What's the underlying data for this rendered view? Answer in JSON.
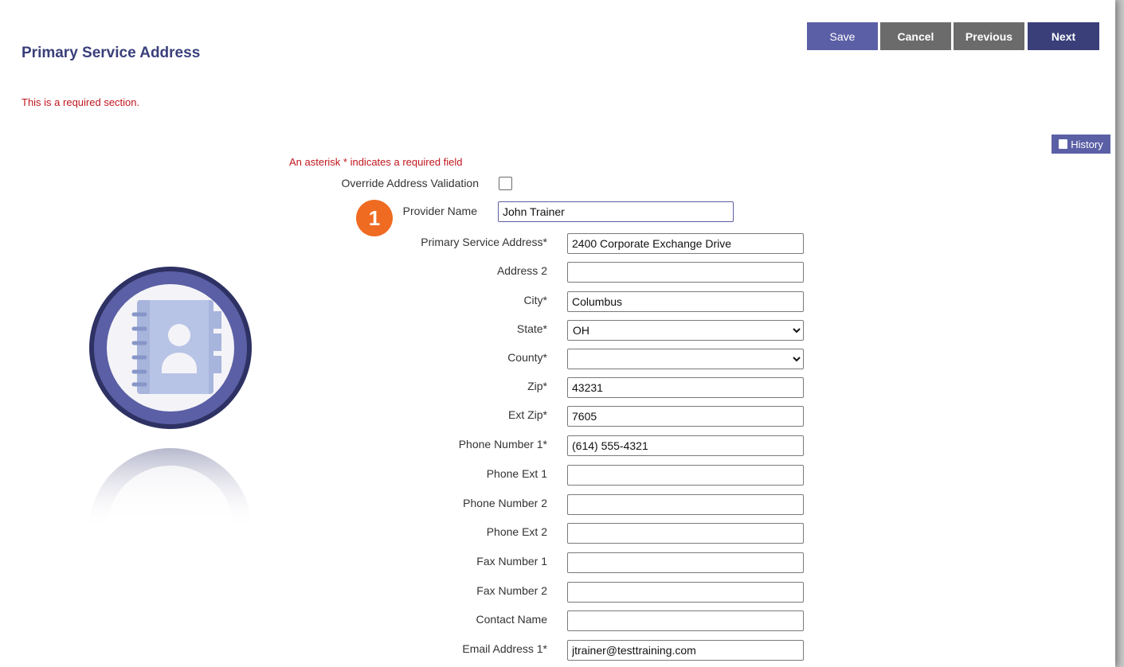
{
  "header": {
    "title": "Primary Service Address",
    "required_section_note": "This is a required section."
  },
  "toolbar": {
    "save": "Save",
    "cancel": "Cancel",
    "previous": "Previous",
    "next": "Next"
  },
  "history_button": "History",
  "form": {
    "asterisk_note": "An asterisk * indicates a required field",
    "override_label": "Override Address Validation",
    "override_checked": false,
    "provider_name_label": "Provider Name",
    "provider_name_value": "John Trainer",
    "step_badge": "1",
    "fields": [
      {
        "label": "Primary Service Address*",
        "value": "2400 Corporate Exchange Drive"
      },
      {
        "label": "Address 2",
        "value": ""
      },
      {
        "label": "City*",
        "value": "Columbus"
      },
      {
        "label": "State*",
        "value": "OH"
      },
      {
        "label": "County*",
        "value": ""
      },
      {
        "label": "Zip*",
        "value": "43231"
      },
      {
        "label": "Ext Zip*",
        "value": "7605"
      },
      {
        "label": "Phone Number 1*",
        "value": "(614) 555-4321"
      },
      {
        "label": "Phone Ext 1",
        "value": ""
      },
      {
        "label": "Phone Number 2",
        "value": ""
      },
      {
        "label": "Phone Ext 2",
        "value": ""
      },
      {
        "label": "Fax Number 1",
        "value": ""
      },
      {
        "label": "Fax Number 2",
        "value": ""
      },
      {
        "label": "Contact Name",
        "value": ""
      },
      {
        "label": "Email Address 1*",
        "value": "jtrainer@testtraining.com"
      }
    ]
  },
  "colors": {
    "primary_button": "#5b5fa5",
    "secondary_button": "#6b6b6b",
    "dark_button": "#3a3f7a",
    "required_text": "#c0171e",
    "badge": "#ef6b22"
  },
  "icons": {
    "emblem": "address-book-icon",
    "history": "history-icon"
  }
}
